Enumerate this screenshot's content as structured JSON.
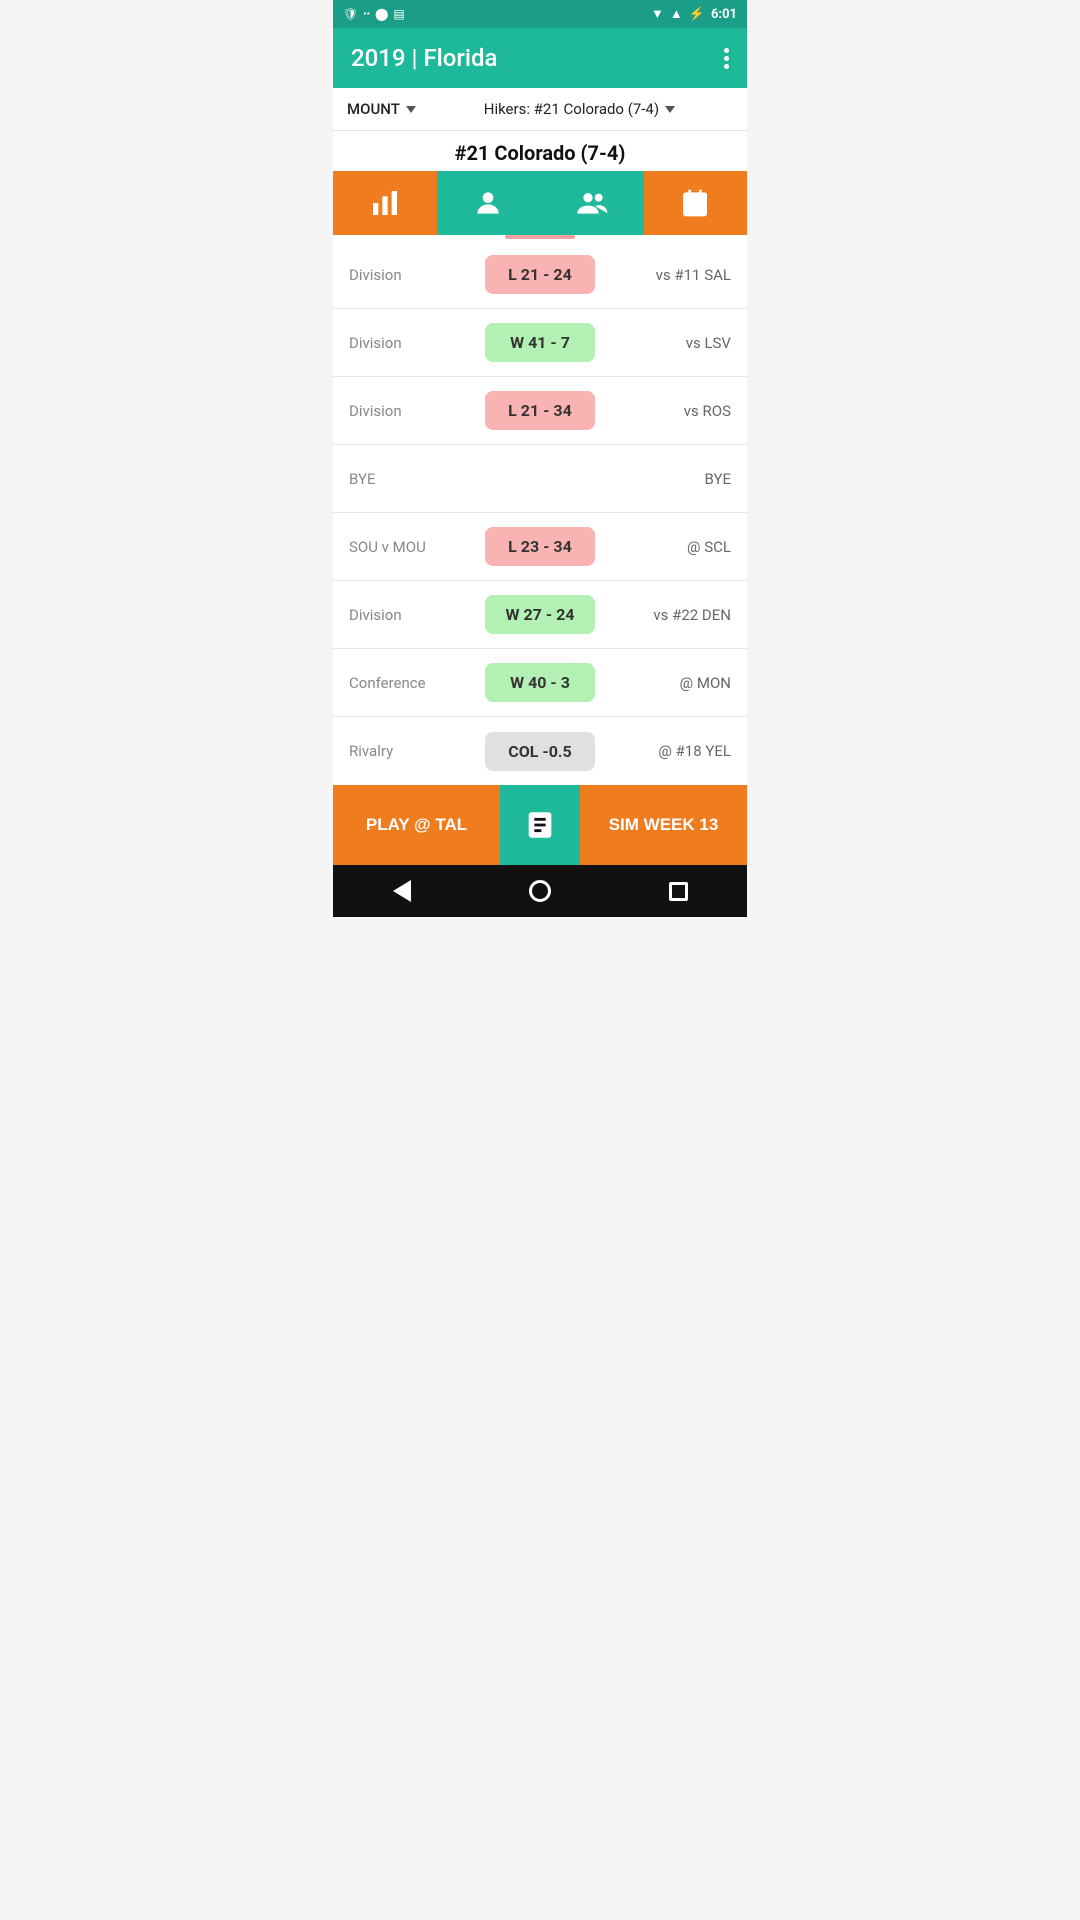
{
  "status_bar": {
    "time": "6:01"
  },
  "header": {
    "title": "2019 | Florida",
    "menu_label": "More options"
  },
  "dropdowns": {
    "mount_label": "MOUNT",
    "hikers_label": "Hikers: #21 Colorado (7-4)"
  },
  "team_title": "#21 Colorado (7-4)",
  "icon_buttons": [
    {
      "name": "stats-button",
      "icon": "bar-chart"
    },
    {
      "name": "player-button",
      "icon": "person"
    },
    {
      "name": "group-button",
      "icon": "group"
    },
    {
      "name": "schedule-button",
      "icon": "calendar"
    }
  ],
  "schedule": {
    "rows": [
      {
        "type": "Division",
        "result": "L 21 - 24",
        "result_class": "result-loss",
        "opponent": "vs #11 SAL"
      },
      {
        "type": "Division",
        "result": "W 41 - 7",
        "result_class": "result-win",
        "opponent": "vs LSV"
      },
      {
        "type": "Division",
        "result": "L 21 - 34",
        "result_class": "result-loss",
        "opponent": "vs ROS"
      },
      {
        "type": "BYE",
        "result": "",
        "result_class": "",
        "opponent": "BYE"
      },
      {
        "type": "SOU v MOU",
        "result": "L 23 - 34",
        "result_class": "result-loss",
        "opponent": "@ SCL"
      },
      {
        "type": "Division",
        "result": "W 27 - 24",
        "result_class": "result-win",
        "opponent": "vs #22 DEN"
      },
      {
        "type": "Conference",
        "result": "W 40 - 3",
        "result_class": "result-win",
        "opponent": "@ MON"
      },
      {
        "type": "Rivalry",
        "result": "COL -0.5",
        "result_class": "result-neutral",
        "opponent": "@ #18 YEL"
      }
    ]
  },
  "action_bar": {
    "play_label": "PLAY @ TAL",
    "sim_label": "SIM WEEK 13"
  },
  "nav": {
    "back_label": "Back",
    "home_label": "Home",
    "recents_label": "Recents"
  }
}
